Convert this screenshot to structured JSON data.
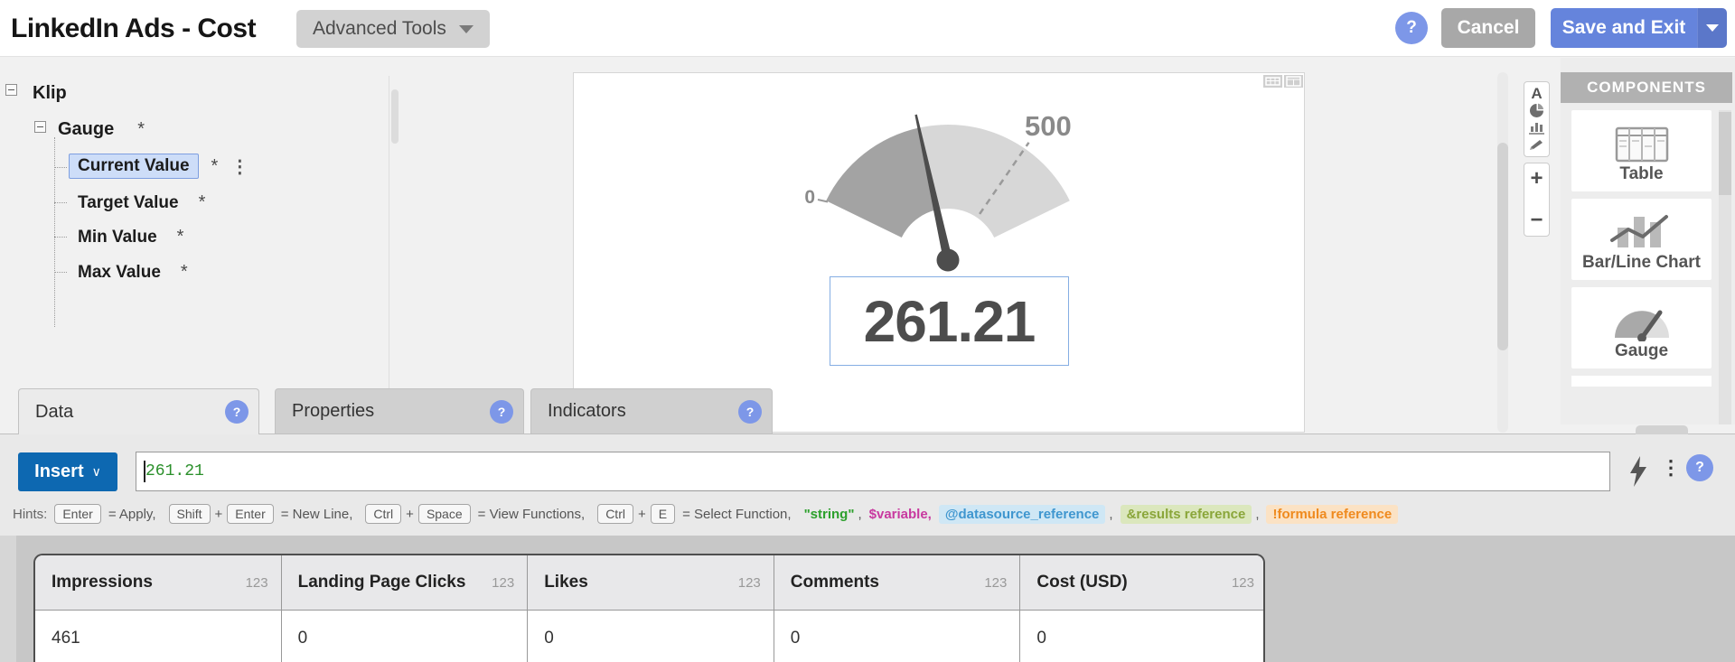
{
  "header": {
    "title": "LinkedIn Ads - Cost",
    "advanced_tools_label": "Advanced Tools",
    "cancel_label": "Cancel",
    "save_and_exit_label": "Save and Exit",
    "help_glyph": "?"
  },
  "tree": {
    "root_label": "Klip",
    "group_label": "Gauge",
    "items": [
      {
        "label": "Current Value",
        "marker": "*",
        "selected": true
      },
      {
        "label": "Target Value",
        "marker": "*",
        "selected": false
      },
      {
        "label": "Min Value",
        "marker": "*",
        "selected": false
      },
      {
        "label": "Max Value",
        "marker": "*",
        "selected": false
      }
    ],
    "group_marker": "*"
  },
  "gauge": {
    "type": "gauge",
    "min": 0,
    "max": 500,
    "value": 261.21,
    "min_label": "0",
    "max_label": "500",
    "value_label": "261.21",
    "filled_color": "#a3a3a3",
    "empty_color": "#d7d7d7",
    "needle_color": "#4d4d4d"
  },
  "canvas_toolbar": {
    "text_tool_glyph": "A",
    "zoom_in_glyph": "+",
    "zoom_out_glyph": "−"
  },
  "components": {
    "title": "COMPONENTS",
    "items": [
      {
        "label": "Table"
      },
      {
        "label": "Bar/Line Chart"
      },
      {
        "label": "Gauge"
      }
    ]
  },
  "tabs": [
    {
      "label": "Data",
      "active": true
    },
    {
      "label": "Properties",
      "active": false
    },
    {
      "label": "Indicators",
      "active": false
    }
  ],
  "formula_bar": {
    "insert_label": "Insert",
    "value": "261.21"
  },
  "hints": {
    "prefix": "Hints:",
    "shortcuts": [
      {
        "key1": "Enter",
        "desc": "= Apply,"
      },
      {
        "key1": "Shift",
        "joiner": "+",
        "key2": "Enter",
        "desc": "= New Line,"
      },
      {
        "key1": "Ctrl",
        "joiner": "+",
        "key2": "Space",
        "desc": "= View Functions,"
      },
      {
        "key1": "Ctrl",
        "joiner": "+",
        "key2": "E",
        "desc": "= Select Function,"
      }
    ],
    "tokens": [
      {
        "text": "\"string\"",
        "sep": ","
      },
      {
        "text": "$variable,",
        "sep": ""
      },
      {
        "text": "@datasource_reference",
        "sep": ","
      },
      {
        "text": "&results reference",
        "sep": ","
      },
      {
        "text": "!formula reference",
        "sep": ""
      }
    ]
  },
  "data_table": {
    "columns": [
      {
        "name": "Impressions",
        "type_badge": "123"
      },
      {
        "name": "Landing Page Clicks",
        "type_badge": "123"
      },
      {
        "name": "Likes",
        "type_badge": "123"
      },
      {
        "name": "Comments",
        "type_badge": "123"
      },
      {
        "name": "Cost (USD)",
        "type_badge": "123"
      }
    ],
    "rows": [
      [
        "461",
        "0",
        "0",
        "0",
        "0"
      ]
    ]
  },
  "icons": {
    "kebab": "⋮",
    "insert_chevron": "∨"
  },
  "colors": {
    "insert_blue": "#0d68b1",
    "save_periwinkle": "#6584dc",
    "help_blue": "#7d97e8",
    "string_green": "#2ca02c",
    "variable_magenta": "#c8399f",
    "datasource_blue": "#3f96cf",
    "results_green": "#8aa63a",
    "formula_orange": "#ef8a1e"
  }
}
